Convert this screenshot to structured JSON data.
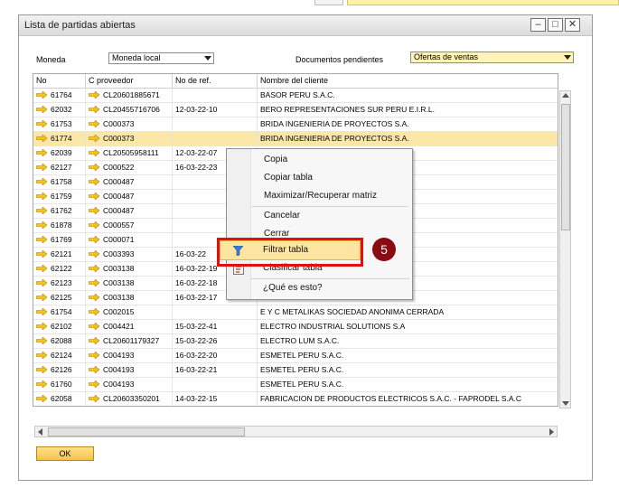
{
  "window": {
    "title": "Lista de partidas abiertas"
  },
  "filters": {
    "moneda_label": "Moneda",
    "moneda_value": "Moneda local",
    "docs_label": "Documentos pendientes",
    "docs_value": "Ofertas de ventas"
  },
  "table": {
    "columns": [
      "No",
      "C proveedor",
      "No de ref.",
      "Nombre del cliente"
    ],
    "rows": [
      {
        "no": "61764",
        "prov": "CL20601885671",
        "ref": "",
        "cliente": "BASOR PERU S.A.C."
      },
      {
        "no": "62032",
        "prov": "CL20455716706",
        "ref": "12-03-22-10",
        "cliente": "BERO REPRESENTACIONES SUR PERU E.I.R.L."
      },
      {
        "no": "61753",
        "prov": "C000373",
        "ref": "",
        "cliente": "BRIDA INGENIERIA DE PROYECTOS S.A."
      },
      {
        "no": "61774",
        "prov": "C000373",
        "ref": "",
        "cliente": "BRIDA INGENIERIA DE PROYECTOS S.A."
      },
      {
        "no": "62039",
        "prov": "CL20505958111",
        "ref": "12-03-22-07",
        "cliente": ""
      },
      {
        "no": "62127",
        "prov": "C000522",
        "ref": "16-03-22-23",
        "cliente": ""
      },
      {
        "no": "61758",
        "prov": "C000487",
        "ref": "",
        "cliente": "A"
      },
      {
        "no": "61759",
        "prov": "C000487",
        "ref": "",
        "cliente": "A"
      },
      {
        "no": "61762",
        "prov": "C000487",
        "ref": "",
        "cliente": "A"
      },
      {
        "no": "61878",
        "prov": "C000557",
        "ref": "",
        "cliente": "ONTAJE ABG S.R.L."
      },
      {
        "no": "61769",
        "prov": "C000071",
        "ref": "",
        "cliente": "COVERSA"
      },
      {
        "no": "62121",
        "prov": "C003393",
        "ref": "16-03-22",
        "cliente": "AC"
      },
      {
        "no": "62122",
        "prov": "C003138",
        "ref": "16-03-22-19",
        "cliente": ""
      },
      {
        "no": "62123",
        "prov": "C003138",
        "ref": "16-03-22-18",
        "cliente": ""
      },
      {
        "no": "62125",
        "prov": "C003138",
        "ref": "16-03-22-17",
        "cliente": ""
      },
      {
        "no": "61754",
        "prov": "C002015",
        "ref": "",
        "cliente": "E Y C METALIKAS SOCIEDAD ANONIMA CERRADA"
      },
      {
        "no": "62102",
        "prov": "C004421",
        "ref": "15-03-22-41",
        "cliente": "ELECTRO INDUSTRIAL SOLUTIONS S.A"
      },
      {
        "no": "62088",
        "prov": "CL20601179327",
        "ref": "15-03-22-26",
        "cliente": "ELECTRO LUM S.A.C."
      },
      {
        "no": "62124",
        "prov": "C004193",
        "ref": "16-03-22-20",
        "cliente": "ESMETEL PERU S.A.C."
      },
      {
        "no": "62126",
        "prov": "C004193",
        "ref": "16-03-22-21",
        "cliente": "ESMETEL PERU S.A.C."
      },
      {
        "no": "61760",
        "prov": "C004193",
        "ref": "",
        "cliente": "ESMETEL PERU S.A.C."
      },
      {
        "no": "62058",
        "prov": "CL20603350201",
        "ref": "14-03-22-15",
        "cliente": "FABRICACION DE PRODUCTOS ELECTRICOS S.A.C. - FAPRODEL S.A.C"
      }
    ],
    "selected_row": 3
  },
  "context_menu": {
    "items": [
      "Copia",
      "Copiar tabla",
      "Maximizar/Recuperar matriz",
      "Cancelar",
      "Cerrar",
      "Filtrar tabla",
      "Clasificar tabla",
      "¿Qué es esto?"
    ]
  },
  "callout": {
    "number": "5"
  },
  "buttons": {
    "ok": "OK"
  },
  "colors": {
    "selected_row": "#fde7a8",
    "highlight": "#e01010",
    "badge": "#8a0b12"
  }
}
